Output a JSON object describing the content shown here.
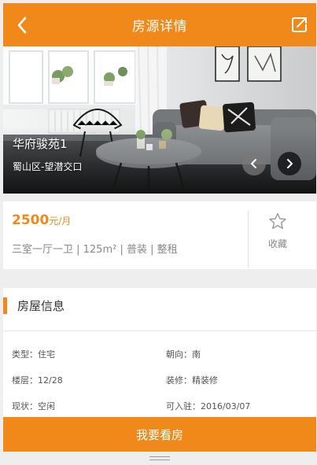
{
  "header": {
    "title": "房源详情",
    "back_icon": "chevron-left-icon",
    "share_icon": "edit-share-icon"
  },
  "hero": {
    "name": "华府骏苑1",
    "location": "蜀山区-望潜交口",
    "prev_icon": "chevron-left-icon",
    "next_icon": "chevron-right-icon"
  },
  "price": {
    "value": "2500",
    "unit": "元/月",
    "spec": "三室一厅一卫 | 125m² | 普装 | 整租"
  },
  "favorite": {
    "label": "收藏",
    "icon": "star-outline-icon"
  },
  "info": {
    "title": "房屋信息",
    "fields": [
      {
        "label": "类型：",
        "value": "住宅"
      },
      {
        "label": "朝向：",
        "value": "南"
      },
      {
        "label": "楼层：",
        "value": "12/28"
      },
      {
        "label": "装修：",
        "value": "精装修"
      },
      {
        "label": "现状：",
        "value": "空闲"
      },
      {
        "label": "可入驻：",
        "value": "2016/03/07"
      }
    ]
  },
  "cta": {
    "label": "我要看房"
  },
  "colors": {
    "accent": "#f0891a",
    "background": "#eeeeee"
  }
}
